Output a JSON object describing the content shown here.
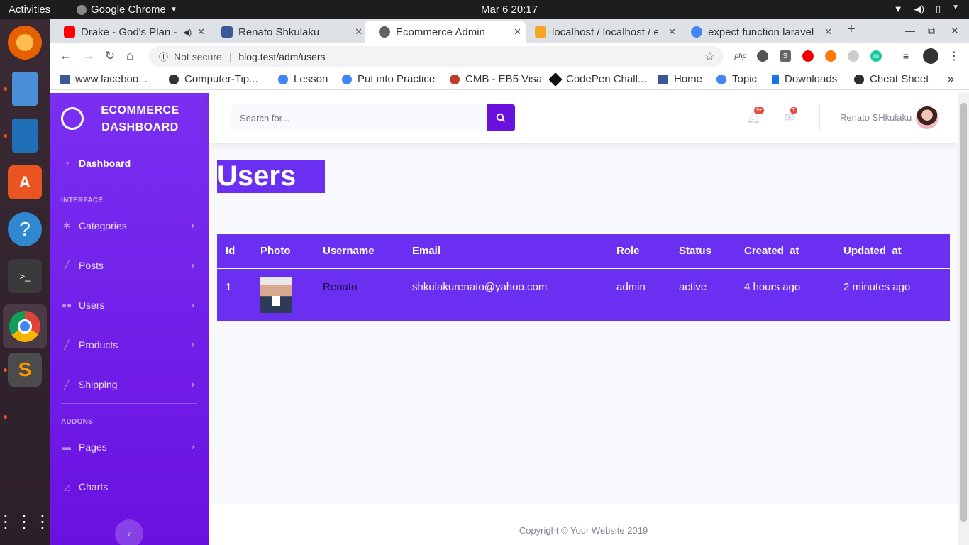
{
  "os": {
    "activities": "Activities",
    "app_name": "Google Chrome",
    "clock": "Mar 6  20:17"
  },
  "tabs": [
    {
      "title": "Drake - God's Plan - ",
      "active": false
    },
    {
      "title": "Renato Shkulaku",
      "active": false
    },
    {
      "title": "Ecommerce Admin",
      "active": true
    },
    {
      "title": "localhost / localhost / e",
      "active": false
    },
    {
      "title": "expect function laravel",
      "active": false
    }
  ],
  "address": {
    "security": "Not secure",
    "url": "blog.test/adm/users"
  },
  "bookmarks": [
    {
      "label": "www.faceboo...",
      "icon": "facebook-icon",
      "color": "#3b5998"
    },
    {
      "label": "Computer-Tip...",
      "icon": "computer-tips-icon",
      "color": "#333333"
    },
    {
      "label": "Lesson",
      "icon": "google-icon",
      "color": "#4285f4"
    },
    {
      "label": "Put into Practice",
      "icon": "google-icon",
      "color": "#4285f4"
    },
    {
      "label": "CMB - EB5 Visa",
      "icon": "cmb-icon",
      "color": "#c0392b"
    },
    {
      "label": "CodePen Chall...",
      "icon": "codepen-icon",
      "color": "#111111"
    },
    {
      "label": "Home",
      "icon": "facebook-icon",
      "color": "#3b5998"
    },
    {
      "label": "Topic",
      "icon": "google-icon",
      "color": "#4285f4"
    },
    {
      "label": "Downloads",
      "icon": "download-icon",
      "color": "#1a73e8"
    },
    {
      "label": "Cheat Sheet",
      "icon": "cheatsheet-icon",
      "color": "#2d2d2d"
    }
  ],
  "sidebar": {
    "brand_line1": "ECOMMERCE",
    "brand_line2": "DASHBOARD",
    "dashboard": "Dashboard",
    "heading_interface": "INTERFACE",
    "heading_addons": "ADDONS",
    "items": [
      {
        "label": "Categories",
        "icon": "gear-icon"
      },
      {
        "label": "Posts",
        "icon": "wrench-icon"
      },
      {
        "label": "Users",
        "icon": "users-icon"
      },
      {
        "label": "Products",
        "icon": "wrench-icon"
      },
      {
        "label": "Shipping",
        "icon": "wrench-icon"
      },
      {
        "label": "Pages",
        "icon": "folder-icon"
      },
      {
        "label": "Charts",
        "icon": "chart-area-icon"
      }
    ]
  },
  "topnav": {
    "search_placeholder": "Search for...",
    "alerts_badge": "3+",
    "messages_badge": "7",
    "user_name": "Renato SHkulaku"
  },
  "page": {
    "title": "Users"
  },
  "table": {
    "headers": [
      "Id",
      "Photo",
      "Username",
      "Email",
      "Role",
      "Status",
      "Created_at",
      "Updated_at"
    ],
    "rows": [
      {
        "id": "1",
        "username": "Renato",
        "email": "shkulakurenato@yahoo.com",
        "role": "admin",
        "status": "active",
        "created_at": "4 hours ago",
        "updated_at": "2 minutes ago"
      }
    ]
  },
  "footer": {
    "copyright": "Copyright © Your Website 2019"
  },
  "colors": {
    "accent": "#6a2ff0",
    "sidebar": "#7a2ff2"
  }
}
